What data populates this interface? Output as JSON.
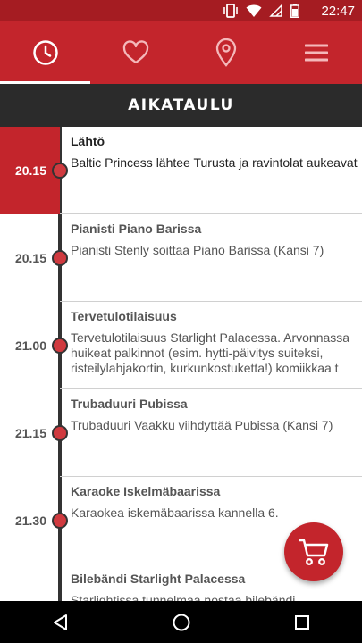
{
  "status_bar": {
    "time": "22:47",
    "icons": [
      "vibrate-icon",
      "wifi-icon",
      "no-sim-icon",
      "battery-icon"
    ]
  },
  "tabs": [
    {
      "name": "schedule",
      "icon": "clock-icon",
      "active": true
    },
    {
      "name": "favorites",
      "icon": "heart-icon",
      "active": false
    },
    {
      "name": "location",
      "icon": "location-pin-icon",
      "active": false
    },
    {
      "name": "menu",
      "icon": "hamburger-menu-icon",
      "active": false
    }
  ],
  "header": {
    "title": "AIKATAULU"
  },
  "colors": {
    "primary": "#c3252c",
    "dark_bar": "#2b2b2b",
    "timeline": "#333333",
    "dot": "#d03a3f"
  },
  "schedule": [
    {
      "time": "20.15",
      "title": "Lähtö",
      "description": "Baltic Princess lähtee Turusta ja ravintolat aukeavat",
      "active": true
    },
    {
      "time": "20.15",
      "title": "Pianisti Piano Barissa",
      "description": "Pianisti Stenly soittaa Piano Barissa (Kansi 7)",
      "active": false
    },
    {
      "time": "21.00",
      "title": "Tervetulotilaisuus",
      "description": "Tervetulotilaisuus Starlight Palacessa. Arvonnassa huikeat palkinnot (esim. hytti-päivitys suiteksi, risteilylahjakortin, kurkunkostuketta!) komiikkaa t",
      "active": false
    },
    {
      "time": "21.15",
      "title": "Trubaduuri Pubissa",
      "description": "Trubaduuri Vaakku viihdyttää Pubissa (Kansi 7)",
      "active": false
    },
    {
      "time": "21.30",
      "title": "Karaoke Iskelmäbaarissa",
      "description": "Karaokea iskemäbaarissa kannella 6.",
      "active": false
    },
    {
      "time": "",
      "title": "Bilebändi Starlight Palacessa",
      "description": "Starlightissa tunnelmaa nostaa bilebändi",
      "active": false
    }
  ],
  "fab": {
    "icon": "shopping-cart-icon"
  },
  "nav_bar": {
    "buttons": [
      "back-icon",
      "home-icon",
      "recents-icon"
    ]
  }
}
